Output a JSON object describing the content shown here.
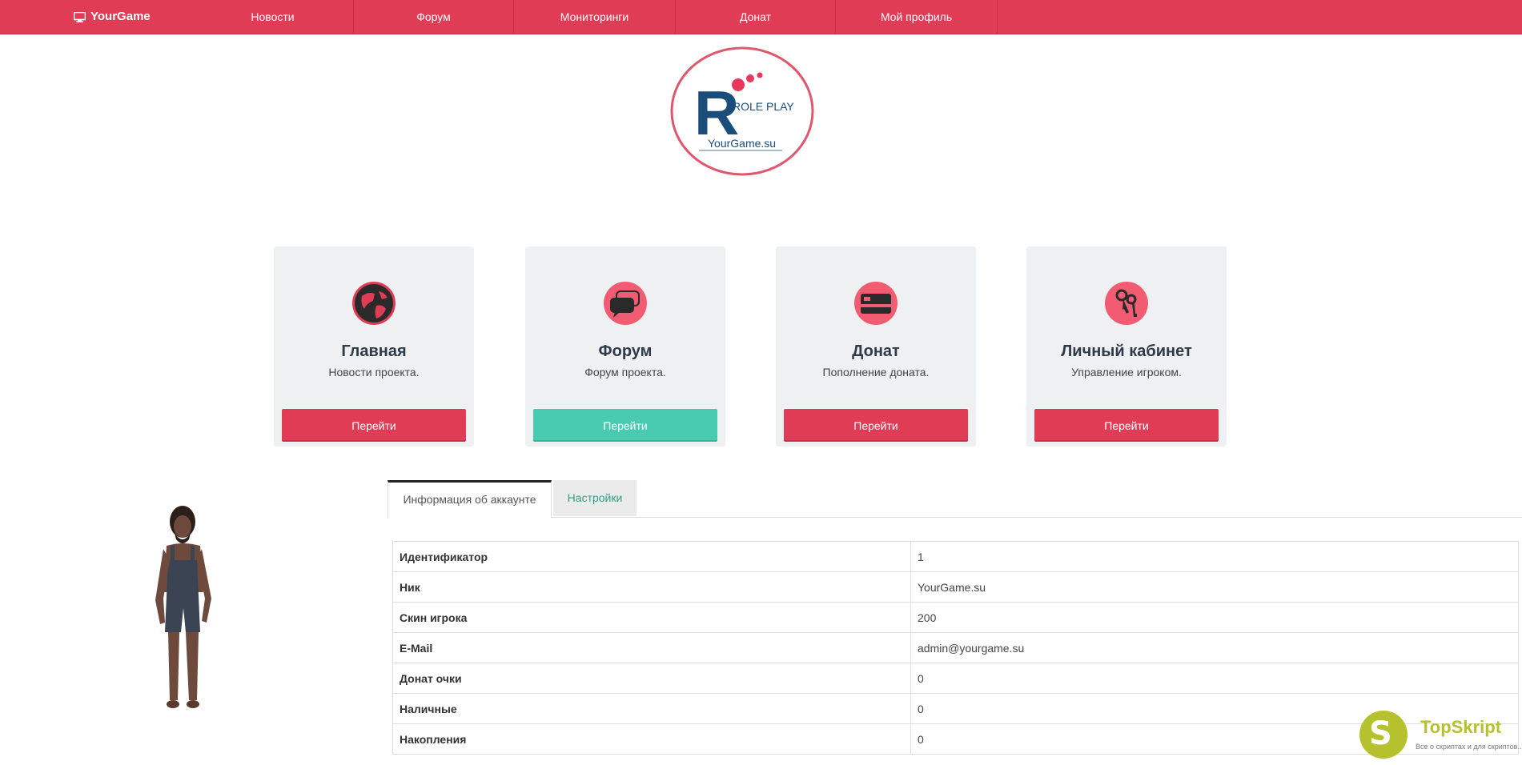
{
  "nav": {
    "brand": "YourGame",
    "items": [
      "Новости",
      "Форум",
      "Мониторинги",
      "Донат",
      "Мой профиль"
    ]
  },
  "logo": {
    "letter": "R",
    "tagline": "ROLE PLAY",
    "site": "YourGame.su"
  },
  "cards": [
    {
      "title": "Главная",
      "desc": "Новости проекта.",
      "button": "Перейти",
      "icon": "globe-icon"
    },
    {
      "title": "Форум",
      "desc": "Форум проекта.",
      "button": "Перейти",
      "icon": "chat-bubbles-icon"
    },
    {
      "title": "Донат",
      "desc": "Пополнение доната.",
      "button": "Перейти",
      "icon": "credit-card-icon"
    },
    {
      "title": "Личный кабинет",
      "desc": "Управление игроком.",
      "button": "Перейти",
      "icon": "keys-icon"
    }
  ],
  "tabs": {
    "active": "Информация об аккаунте",
    "other": "Настройки"
  },
  "account": [
    {
      "label": "Идентификатор",
      "value": "1"
    },
    {
      "label": "Ник",
      "value": "YourGame.su"
    },
    {
      "label": "Скин игрока",
      "value": "200"
    },
    {
      "label": "E-Mail",
      "value": "admin@yourgame.su"
    },
    {
      "label": "Донат очки",
      "value": "0"
    },
    {
      "label": "Наличные",
      "value": "0"
    },
    {
      "label": "Накопления",
      "value": "0"
    }
  ],
  "watermark": {
    "letter": "S",
    "name": "TopSkript",
    "sub": "Все о скриптах и для скриптов..."
  },
  "colors": {
    "accent": "#e03c56",
    "teal": "#48cbb0",
    "icon_bg": "#f25c72"
  }
}
